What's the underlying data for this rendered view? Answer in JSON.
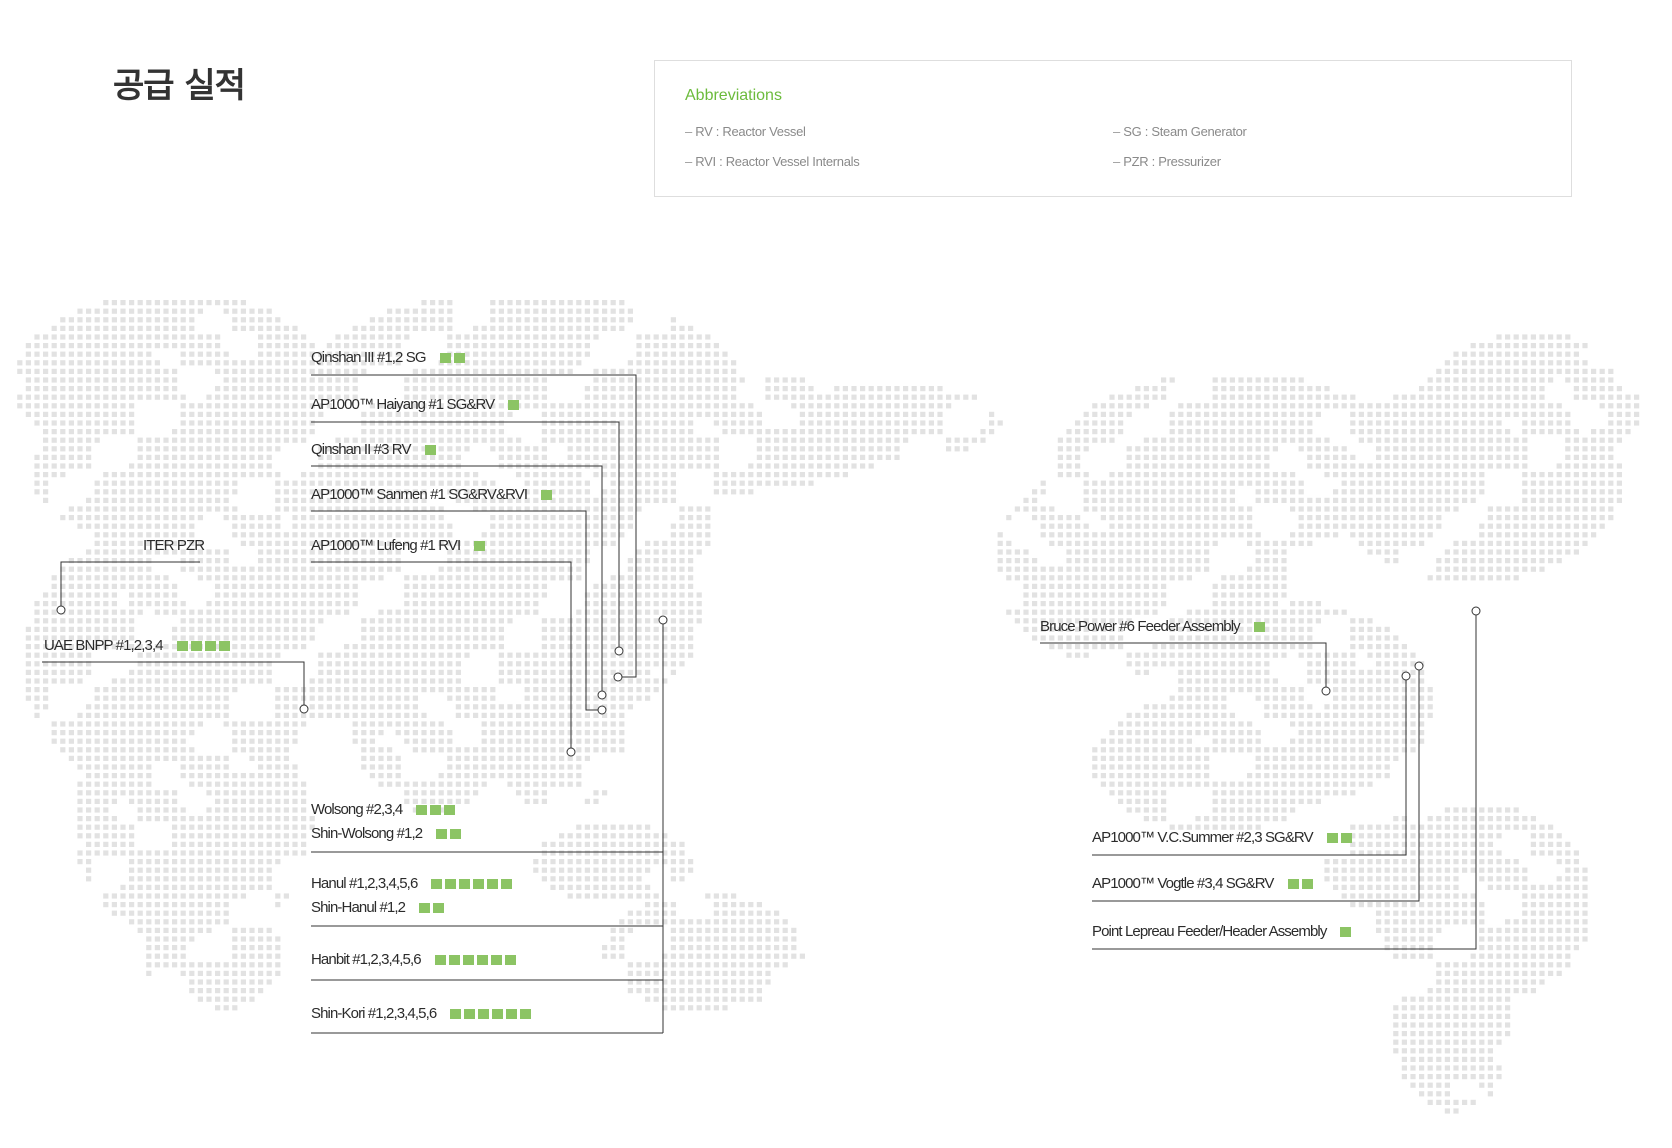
{
  "page": {
    "title": "공급 실적"
  },
  "abbreviations": {
    "title": "Abbreviations",
    "items": [
      "RV : Reactor Vessel",
      "SG : Steam Generator",
      "RVI : Reactor Vessel Internals",
      "PZR : Pressurizer"
    ]
  },
  "projects": [
    {
      "label": "Qinshan III #1,2 SG",
      "count": 2
    },
    {
      "label": "AP1000™ Haiyang #1 SG&RV",
      "count": 1
    },
    {
      "label": "Qinshan II #3 RV",
      "count": 1
    },
    {
      "label": "AP1000™ Sanmen #1 SG&RV&RVI",
      "count": 1
    },
    {
      "label": "AP1000™ Lufeng #1 RVI",
      "count": 1
    },
    {
      "label": "ITER PZR",
      "count": 0
    },
    {
      "label": "UAE BNPP #1,2,3,4",
      "count": 4
    },
    {
      "label": "Wolsong #2,3,4",
      "count": 3
    },
    {
      "label": "Shin-Wolsong #1,2",
      "count": 2
    },
    {
      "label": "Hanul #1,2,3,4,5,6",
      "count": 6
    },
    {
      "label": "Shin-Hanul #1,2",
      "count": 2
    },
    {
      "label": "Hanbit #1,2,3,4,5,6",
      "count": 6
    },
    {
      "label": "Shin-Kori #1,2,3,4,5,6",
      "count": 6
    },
    {
      "label": "Bruce Power #6 Feeder Assembly",
      "count": 1
    },
    {
      "label": "AP1000™ V.C.Summer #2,3 SG&RV",
      "count": 2
    },
    {
      "label": "AP1000™ Vogtle #3,4 SG&RV",
      "count": 2
    },
    {
      "label": "Point Lepreau Feeder/Header Assembly",
      "count": 1
    }
  ],
  "colors": {
    "accent": "#6cbb3c",
    "square": "#8cc464",
    "map_dot": "#e2e2e2",
    "line": "#333333"
  }
}
